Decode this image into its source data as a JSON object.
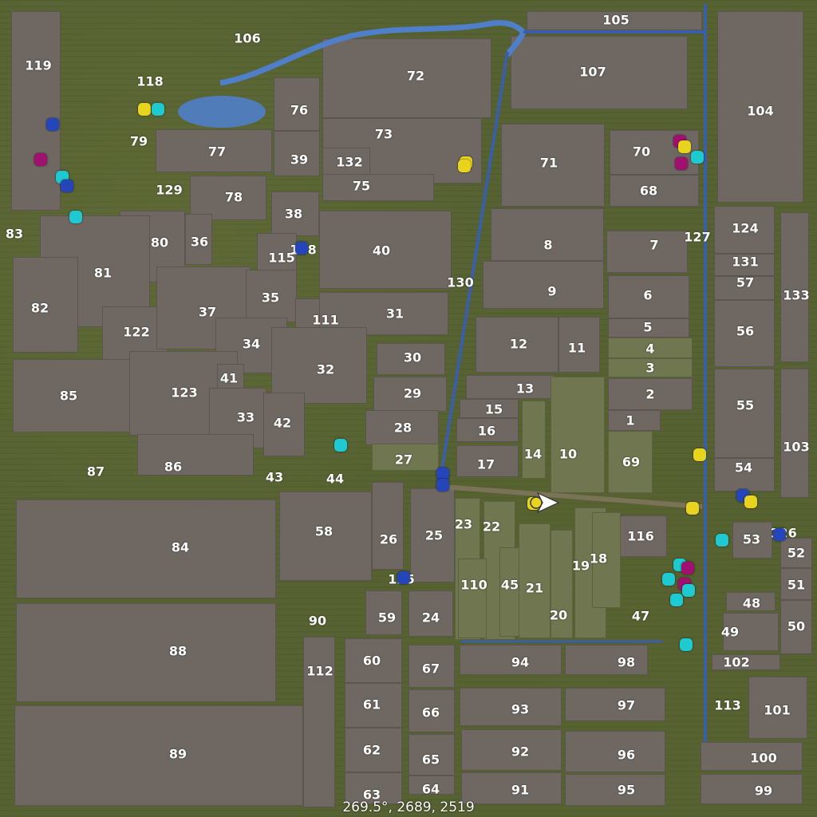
{
  "colors": {
    "field": "#6f6862",
    "green_field": "#6f7650",
    "road": "#3a5ea8",
    "water": "#4f7fc8"
  },
  "marker_types": {
    "yellow": "#e8d41e",
    "cyan": "#1ec9cf",
    "blue": "#2446b8",
    "magenta": "#a0106e"
  },
  "coordinates": "269.5°, 2689, 2519",
  "fields": [
    {
      "n": "119",
      "r": [
        14,
        14,
        62,
        250
      ]
    },
    {
      "n": "106",
      "r": null
    },
    {
      "n": "76",
      "r": [
        343,
        97,
        58,
        67
      ]
    },
    {
      "n": "39",
      "r": [
        343,
        164,
        58,
        57
      ]
    },
    {
      "n": "72",
      "r": [
        404,
        48,
        212,
        100
      ]
    },
    {
      "n": "73",
      "r": [
        404,
        148,
        200,
        82
      ]
    },
    {
      "n": "132",
      "r": [
        404,
        185,
        60,
        35
      ]
    },
    {
      "n": "75",
      "r": [
        404,
        218,
        140,
        34
      ]
    },
    {
      "n": "77",
      "r": [
        195,
        162,
        146,
        54
      ]
    },
    {
      "n": "78",
      "r": [
        238,
        220,
        96,
        56
      ]
    },
    {
      "n": "105",
      "r": [
        660,
        14,
        220,
        24
      ]
    },
    {
      "n": "107",
      "r": [
        640,
        45,
        222,
        92
      ]
    },
    {
      "n": "104",
      "r": [
        899,
        14,
        108,
        240
      ]
    },
    {
      "n": "71",
      "r": [
        628,
        155,
        130,
        104
      ]
    },
    {
      "n": "70",
      "r": [
        764,
        163,
        112,
        56
      ]
    },
    {
      "n": "68",
      "r": [
        764,
        219,
        112,
        40
      ]
    },
    {
      "n": "38",
      "r": [
        340,
        240,
        60,
        56
      ]
    },
    {
      "n": "40",
      "r": [
        400,
        264,
        166,
        98
      ]
    },
    {
      "n": "8",
      "r": [
        615,
        261,
        142,
        66
      ]
    },
    {
      "n": "9",
      "r": [
        605,
        327,
        152,
        60
      ]
    },
    {
      "n": "7",
      "r": [
        760,
        289,
        102,
        53
      ]
    },
    {
      "n": "124",
      "r": [
        895,
        258,
        76,
        60
      ]
    },
    {
      "n": "131",
      "r": [
        895,
        318,
        76,
        28
      ]
    },
    {
      "n": "57",
      "r": [
        895,
        346,
        76,
        30
      ]
    },
    {
      "n": "133",
      "r": [
        978,
        266,
        36,
        188
      ]
    },
    {
      "n": "80",
      "r": [
        150,
        264,
        82,
        90
      ]
    },
    {
      "n": "36",
      "r": [
        232,
        268,
        34,
        64
      ]
    },
    {
      "n": "115",
      "r": [
        322,
        292,
        50,
        64
      ]
    },
    {
      "n": "81",
      "r": [
        50,
        270,
        138,
        140
      ]
    },
    {
      "n": "82",
      "r": [
        16,
        322,
        82,
        120
      ]
    },
    {
      "n": "122",
      "r": [
        128,
        384,
        82,
        70
      ]
    },
    {
      "n": "37",
      "r": [
        196,
        334,
        118,
        104
      ]
    },
    {
      "n": "35",
      "r": [
        308,
        338,
        64,
        66
      ]
    },
    {
      "n": "111",
      "r": [
        370,
        374,
        90,
        60
      ]
    },
    {
      "n": "31",
      "r": [
        400,
        366,
        162,
        54
      ]
    },
    {
      "n": "34",
      "r": [
        270,
        398,
        90,
        70
      ]
    },
    {
      "n": "6",
      "r": [
        762,
        345,
        102,
        54
      ]
    },
    {
      "n": "5",
      "r": [
        762,
        399,
        102,
        24
      ]
    },
    {
      "n": "56",
      "r": [
        895,
        376,
        76,
        84
      ]
    },
    {
      "n": "12",
      "r": [
        596,
        397,
        104,
        70
      ]
    },
    {
      "n": "11",
      "r": [
        700,
        397,
        52,
        70
      ]
    },
    {
      "n": "4",
      "r": [
        762,
        423,
        106,
        26
      ],
      "g": true
    },
    {
      "n": "3",
      "r": [
        762,
        449,
        106,
        24
      ],
      "g": true
    },
    {
      "n": "85",
      "r": [
        16,
        450,
        166,
        92
      ]
    },
    {
      "n": "123",
      "r": [
        162,
        440,
        136,
        106
      ]
    },
    {
      "n": "41",
      "r": [
        272,
        456,
        34,
        36
      ]
    },
    {
      "n": "32",
      "r": [
        340,
        410,
        120,
        96
      ]
    },
    {
      "n": "30",
      "r": [
        472,
        430,
        86,
        40
      ]
    },
    {
      "n": "13",
      "r": [
        584,
        470,
        112,
        30
      ]
    },
    {
      "n": "29",
      "r": [
        468,
        472,
        92,
        44
      ]
    },
    {
      "n": "2",
      "r": [
        762,
        474,
        106,
        40
      ]
    },
    {
      "n": "55",
      "r": [
        895,
        462,
        76,
        112
      ]
    },
    {
      "n": "103",
      "r": [
        978,
        462,
        36,
        162
      ]
    },
    {
      "n": "33",
      "r": [
        262,
        486,
        72,
        76
      ]
    },
    {
      "n": "42",
      "r": [
        330,
        492,
        52,
        80
      ]
    },
    {
      "n": "15",
      "r": [
        576,
        500,
        74,
        24
      ]
    },
    {
      "n": "28",
      "r": [
        458,
        514,
        92,
        44
      ]
    },
    {
      "n": "1",
      "r": [
        762,
        514,
        66,
        26
      ]
    },
    {
      "n": "16",
      "r": [
        572,
        524,
        78,
        30
      ]
    },
    {
      "n": "14",
      "r": [
        654,
        502,
        30,
        98
      ],
      "g": true
    },
    {
      "n": "10",
      "r": [
        690,
        472,
        68,
        146
      ],
      "g": true
    },
    {
      "n": "27",
      "r": [
        466,
        556,
        84,
        34
      ],
      "g": true
    },
    {
      "n": "17",
      "r": [
        572,
        558,
        78,
        40
      ]
    },
    {
      "n": "69",
      "r": [
        762,
        540,
        56,
        78
      ],
      "g": true
    },
    {
      "n": "54",
      "r": [
        895,
        574,
        76,
        42
      ]
    },
    {
      "n": "86",
      "r": [
        172,
        544,
        146,
        52
      ]
    },
    {
      "n": "84",
      "r": [
        20,
        626,
        326,
        124
      ]
    },
    {
      "n": "58",
      "r": [
        350,
        616,
        116,
        112
      ]
    },
    {
      "n": "26",
      "r": [
        466,
        604,
        40,
        110
      ]
    },
    {
      "n": "25",
      "r": [
        514,
        612,
        56,
        118
      ]
    },
    {
      "n": "23",
      "r": [
        570,
        624,
        32,
        178
      ],
      "g": true
    },
    {
      "n": "22",
      "r": [
        606,
        628,
        40,
        174
      ],
      "g": true
    },
    {
      "n": "116",
      "r": [
        768,
        646,
        68,
        52
      ]
    },
    {
      "n": "53",
      "r": [
        918,
        654,
        50,
        46
      ]
    },
    {
      "n": "52",
      "r": [
        978,
        674,
        40,
        38
      ]
    },
    {
      "n": "51",
      "r": [
        978,
        712,
        40,
        40
      ]
    },
    {
      "n": "110",
      "r": [
        574,
        700,
        36,
        100
      ],
      "g": true
    },
    {
      "n": "45",
      "r": [
        626,
        686,
        34,
        112
      ],
      "g": true
    },
    {
      "n": "21",
      "r": [
        650,
        656,
        40,
        144
      ],
      "g": true
    },
    {
      "n": "19",
      "r": [
        720,
        636,
        40,
        164
      ],
      "g": true
    },
    {
      "n": "18",
      "r": [
        742,
        642,
        36,
        120
      ],
      "g": true
    },
    {
      "n": "20",
      "r": [
        690,
        664,
        28,
        136
      ],
      "g": true
    },
    {
      "n": "48",
      "r": [
        910,
        742,
        62,
        24
      ]
    },
    {
      "n": "50",
      "r": [
        978,
        752,
        40,
        68
      ]
    },
    {
      "n": "49",
      "r": [
        906,
        768,
        70,
        48
      ]
    },
    {
      "n": "59",
      "r": [
        458,
        740,
        46,
        56
      ]
    },
    {
      "n": "24",
      "r": [
        512,
        740,
        56,
        58
      ]
    },
    {
      "n": "88",
      "r": [
        20,
        756,
        326,
        124
      ]
    },
    {
      "n": "112",
      "r": [
        380,
        798,
        40,
        214
      ]
    },
    {
      "n": "60",
      "r": [
        432,
        800,
        72,
        56
      ]
    },
    {
      "n": "67",
      "r": [
        512,
        808,
        58,
        54
      ]
    },
    {
      "n": "94",
      "r": [
        576,
        808,
        128,
        38
      ]
    },
    {
      "n": "98",
      "r": [
        708,
        808,
        104,
        38
      ]
    },
    {
      "n": "102",
      "r": [
        892,
        820,
        86,
        20
      ]
    },
    {
      "n": "61",
      "r": [
        432,
        856,
        72,
        56
      ]
    },
    {
      "n": "66",
      "r": [
        512,
        864,
        58,
        54
      ]
    },
    {
      "n": "93",
      "r": [
        576,
        862,
        128,
        48
      ]
    },
    {
      "n": "97",
      "r": [
        708,
        862,
        126,
        42
      ]
    },
    {
      "n": "101",
      "r": [
        938,
        848,
        74,
        78
      ]
    },
    {
      "n": "89",
      "r": [
        18,
        884,
        362,
        126
      ]
    },
    {
      "n": "62",
      "r": [
        432,
        912,
        72,
        56
      ]
    },
    {
      "n": "65",
      "r": [
        512,
        920,
        58,
        52
      ]
    },
    {
      "n": "92",
      "r": [
        578,
        914,
        126,
        52
      ]
    },
    {
      "n": "96",
      "r": [
        708,
        916,
        126,
        52
      ]
    },
    {
      "n": "100",
      "r": [
        878,
        930,
        128,
        36
      ]
    },
    {
      "n": "63",
      "r": [
        432,
        968,
        72,
        40
      ]
    },
    {
      "n": "64",
      "r": [
        512,
        972,
        58,
        24
      ]
    },
    {
      "n": "91",
      "r": [
        578,
        968,
        126,
        40
      ]
    },
    {
      "n": "95",
      "r": [
        708,
        970,
        126,
        40
      ]
    },
    {
      "n": "99",
      "r": [
        878,
        970,
        128,
        38
      ]
    }
  ],
  "labels": [
    [
      "119",
      48,
      82
    ],
    [
      "106",
      310,
      48
    ],
    [
      "118",
      188,
      102
    ],
    [
      "79",
      174,
      177
    ],
    [
      "77",
      272,
      190
    ],
    [
      "129",
      212,
      238
    ],
    [
      "78",
      293,
      247
    ],
    [
      "76",
      375,
      138
    ],
    [
      "39",
      375,
      200
    ],
    [
      "72",
      521,
      95
    ],
    [
      "73",
      481,
      168
    ],
    [
      "132",
      438,
      203
    ],
    [
      "75",
      453,
      233
    ],
    [
      "105",
      772,
      25
    ],
    [
      "107",
      743,
      90
    ],
    [
      "104",
      953,
      139
    ],
    [
      "71",
      688,
      204
    ],
    [
      "70",
      804,
      190
    ],
    [
      "68",
      813,
      239
    ],
    [
      "83",
      18,
      293
    ],
    [
      "80",
      200,
      304
    ],
    [
      "36",
      250,
      303
    ],
    [
      "38",
      368,
      268
    ],
    [
      "115",
      353,
      323
    ],
    [
      "128",
      380,
      313
    ],
    [
      "40",
      478,
      314
    ],
    [
      "8",
      687,
      307
    ],
    [
      "7",
      820,
      307
    ],
    [
      "127",
      874,
      297
    ],
    [
      "124",
      934,
      286
    ],
    [
      "131",
      934,
      328
    ],
    [
      "57",
      934,
      354
    ],
    [
      "133",
      998,
      370
    ],
    [
      "81",
      129,
      342
    ],
    [
      "82",
      50,
      386
    ],
    [
      "37",
      260,
      391
    ],
    [
      "35",
      339,
      373
    ],
    [
      "130",
      577,
      354
    ],
    [
      "9",
      692,
      365
    ],
    [
      "6",
      812,
      370
    ],
    [
      "111",
      408,
      401
    ],
    [
      "31",
      495,
      393
    ],
    [
      "5",
      812,
      410
    ],
    [
      "56",
      934,
      415
    ],
    [
      "122",
      171,
      416
    ],
    [
      "34",
      315,
      431
    ],
    [
      "12",
      650,
      431
    ],
    [
      "11",
      723,
      436
    ],
    [
      "4",
      815,
      437
    ],
    [
      "3",
      815,
      461
    ],
    [
      "30",
      517,
      448
    ],
    [
      "32",
      408,
      463
    ],
    [
      "41",
      287,
      474
    ],
    [
      "85",
      86,
      496
    ],
    [
      "123",
      231,
      492
    ],
    [
      "13",
      658,
      487
    ],
    [
      "29",
      517,
      493
    ],
    [
      "2",
      815,
      494
    ],
    [
      "55",
      934,
      508
    ],
    [
      "15",
      619,
      513
    ],
    [
      "33",
      308,
      523
    ],
    [
      "42",
      354,
      530
    ],
    [
      "28",
      505,
      536
    ],
    [
      "1",
      790,
      527
    ],
    [
      "16",
      610,
      540
    ],
    [
      "14",
      668,
      569
    ],
    [
      "10",
      712,
      569
    ],
    [
      "103",
      998,
      560
    ],
    [
      "27",
      506,
      576
    ],
    [
      "17",
      609,
      582
    ],
    [
      "69",
      791,
      579
    ],
    [
      "54",
      932,
      586
    ],
    [
      "87",
      120,
      591
    ],
    [
      "86",
      217,
      585
    ],
    [
      "43",
      344,
      598
    ],
    [
      "44",
      420,
      600
    ],
    [
      "84",
      226,
      686
    ],
    [
      "58",
      406,
      666
    ],
    [
      "26",
      487,
      676
    ],
    [
      "25",
      544,
      671
    ],
    [
      "23",
      581,
      657
    ],
    [
      "22",
      616,
      660
    ],
    [
      "116",
      803,
      672
    ],
    [
      "53",
      942,
      676
    ],
    [
      "126",
      982,
      668
    ],
    [
      "52",
      998,
      693
    ],
    [
      "18",
      750,
      700
    ],
    [
      "125",
      503,
      726
    ],
    [
      "110",
      594,
      733
    ],
    [
      "45",
      639,
      733
    ],
    [
      "21",
      670,
      737
    ],
    [
      "19",
      728,
      709
    ],
    [
      "51",
      998,
      733
    ],
    [
      "48",
      942,
      756
    ],
    [
      "47",
      803,
      772
    ],
    [
      "90",
      398,
      778
    ],
    [
      "59",
      485,
      774
    ],
    [
      "24",
      540,
      774
    ],
    [
      "20",
      700,
      771
    ],
    [
      "49",
      915,
      792
    ],
    [
      "50",
      998,
      785
    ],
    [
      "88",
      223,
      816
    ],
    [
      "112",
      401,
      841
    ],
    [
      "60",
      466,
      828
    ],
    [
      "67",
      540,
      838
    ],
    [
      "94",
      652,
      830
    ],
    [
      "98",
      785,
      830
    ],
    [
      "102",
      923,
      830
    ],
    [
      "113",
      912,
      884
    ],
    [
      "101",
      974,
      890
    ],
    [
      "61",
      466,
      883
    ],
    [
      "66",
      540,
      893
    ],
    [
      "93",
      652,
      889
    ],
    [
      "97",
      785,
      884
    ],
    [
      "89",
      223,
      945
    ],
    [
      "62",
      466,
      940
    ],
    [
      "65",
      540,
      952
    ],
    [
      "92",
      652,
      942
    ],
    [
      "96",
      785,
      946
    ],
    [
      "100",
      957,
      950
    ],
    [
      "63",
      466,
      996
    ],
    [
      "64",
      540,
      989
    ],
    [
      "91",
      652,
      990
    ],
    [
      "95",
      785,
      990
    ],
    [
      "99",
      957,
      991
    ]
  ],
  "markers": [
    [
      "yellow",
      181,
      137
    ],
    [
      "cyan",
      198,
      137
    ],
    [
      "blue",
      66,
      156
    ],
    [
      "magenta",
      51,
      200
    ],
    [
      "cyan",
      78,
      222
    ],
    [
      "blue",
      84,
      233
    ],
    [
      "cyan",
      95,
      272
    ],
    [
      "yellow",
      584,
      204
    ],
    [
      "yellow",
      582,
      208
    ],
    [
      "magenta",
      852,
      177
    ],
    [
      "yellow",
      858,
      184
    ],
    [
      "cyan",
      874,
      197
    ],
    [
      "magenta",
      854,
      205
    ],
    [
      "blue",
      378,
      311
    ],
    [
      "cyan",
      427,
      558
    ],
    [
      "yellow",
      877,
      570
    ],
    [
      "blue",
      555,
      594
    ],
    [
      "blue",
      555,
      608
    ],
    [
      "yellow",
      669,
      631
    ],
    [
      "yellow",
      868,
      637
    ],
    [
      "blue",
      931,
      621
    ],
    [
      "yellow",
      941,
      629
    ],
    [
      "cyan",
      905,
      677
    ],
    [
      "blue",
      977,
      670
    ],
    [
      "cyan",
      852,
      708
    ],
    [
      "magenta",
      862,
      712
    ],
    [
      "cyan",
      838,
      726
    ],
    [
      "magenta",
      858,
      732
    ],
    [
      "cyan",
      863,
      740
    ],
    [
      "cyan",
      848,
      752
    ],
    [
      "blue",
      506,
      724
    ],
    [
      "cyan",
      860,
      808
    ]
  ]
}
